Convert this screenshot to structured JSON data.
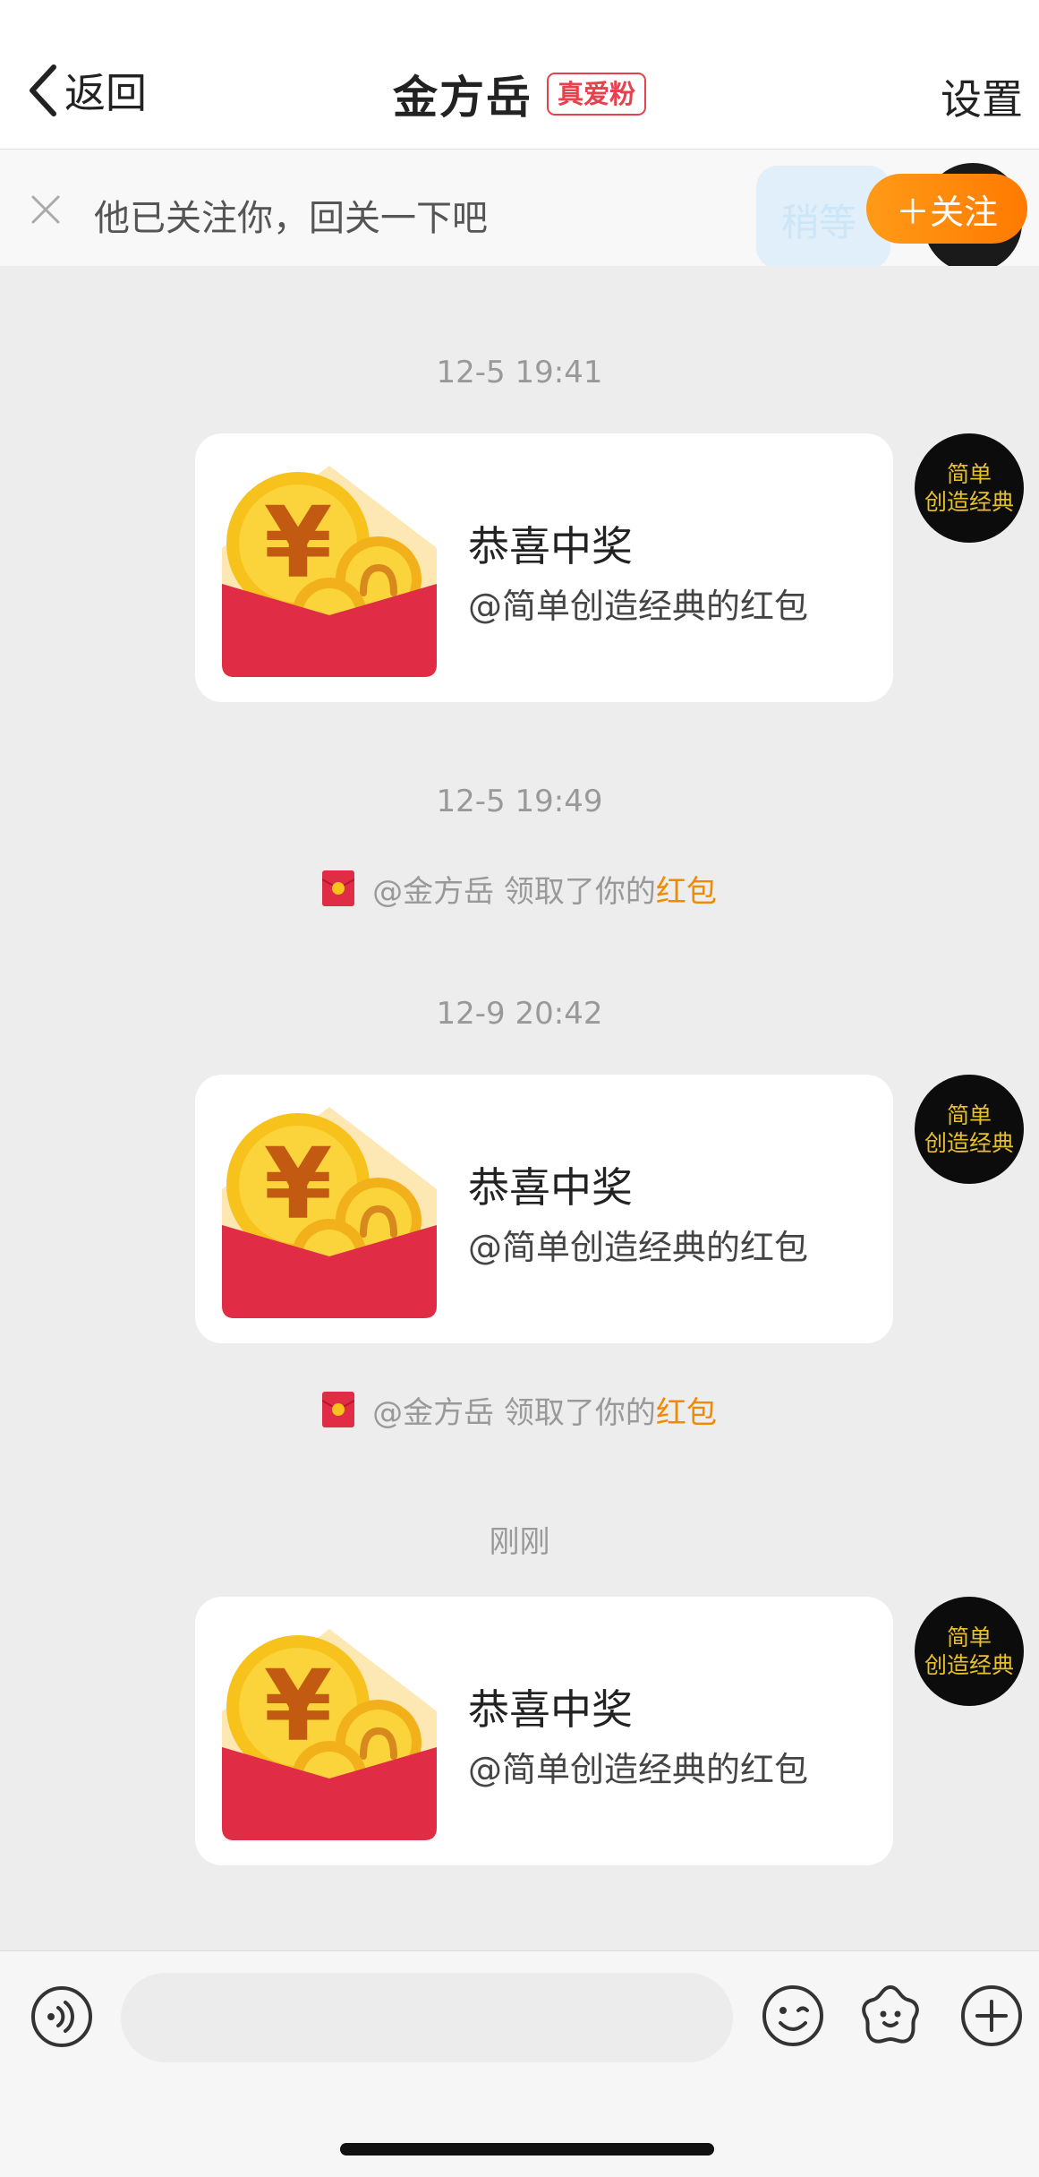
{
  "header": {
    "back_label": "返回",
    "title": "金方岳",
    "fan_badge": "真爱粉",
    "settings_label": "设置"
  },
  "follow_bar": {
    "text": "他已关注你，回关一下吧",
    "button_label": "＋关注",
    "overlay_text": "稍等"
  },
  "avatar": {
    "line1": "简单",
    "line2": "创造经典"
  },
  "messages": [
    {
      "time": "12-5 19:41",
      "title": "恭喜中奖",
      "subtitle": "@简单创造经典的红包"
    },
    {
      "time": "12-9 20:42",
      "title": "恭喜中奖",
      "subtitle": "@简单创造经典的红包"
    },
    {
      "time": "刚刚",
      "title": "恭喜中奖",
      "subtitle": "@简单创造经典的红包"
    }
  ],
  "notices": [
    {
      "time": "12-5 19:49",
      "prefix": "@金方岳 领取了你的",
      "highlight": "红包"
    },
    {
      "prefix": "@金方岳 领取了你的",
      "highlight": "红包"
    }
  ],
  "colors": {
    "accent_orange": "#ff8a00",
    "badge_red": "#e8404c",
    "envelope_red": "#e12c46",
    "coin_gold": "#f7c21b"
  },
  "icons": {
    "voice": "voice-icon",
    "emoji": "emoji-icon",
    "sticker": "sticker-icon",
    "plus": "plus-icon",
    "back": "chevron-left-icon",
    "close": "close-icon",
    "red_packet": "red-packet-icon"
  }
}
